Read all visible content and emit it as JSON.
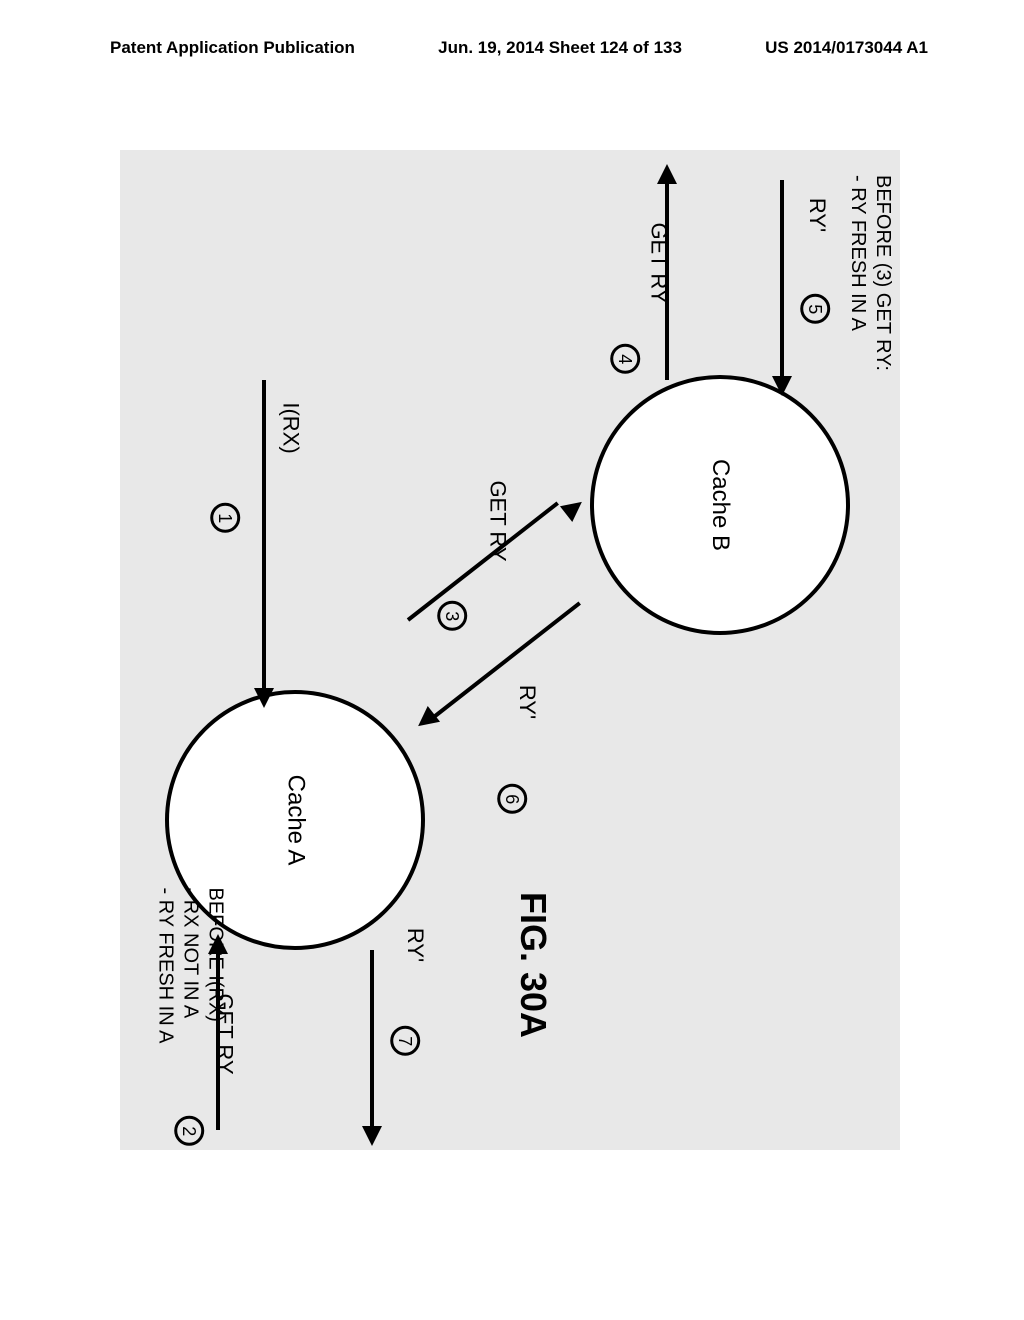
{
  "header": {
    "left": "Patent Application Publication",
    "center": "Jun. 19, 2014  Sheet 124 of 133",
    "right": "US 2014/0173044 A1"
  },
  "nodes": {
    "a": "Cache A",
    "b": "Cache B"
  },
  "steps": {
    "s1": {
      "num": "1",
      "label": "I(RX)"
    },
    "s2": {
      "num": "2",
      "label": "GET RY"
    },
    "s3": {
      "num": "3",
      "label": "GET RY"
    },
    "s4": {
      "num": "4",
      "label": "GET RY"
    },
    "s5": {
      "num": "5",
      "label": "RY'"
    },
    "s6": {
      "num": "6",
      "label": "RY'"
    },
    "s7": {
      "num": "7",
      "label": "RY'"
    }
  },
  "notes": {
    "a": "BEFORE I(RX)\n- RX NOT IN A\n- RY FRESH IN A",
    "b": "BEFORE (3) GET RY:\n- RY FRESH IN A"
  },
  "caption": "FIG. 30A"
}
